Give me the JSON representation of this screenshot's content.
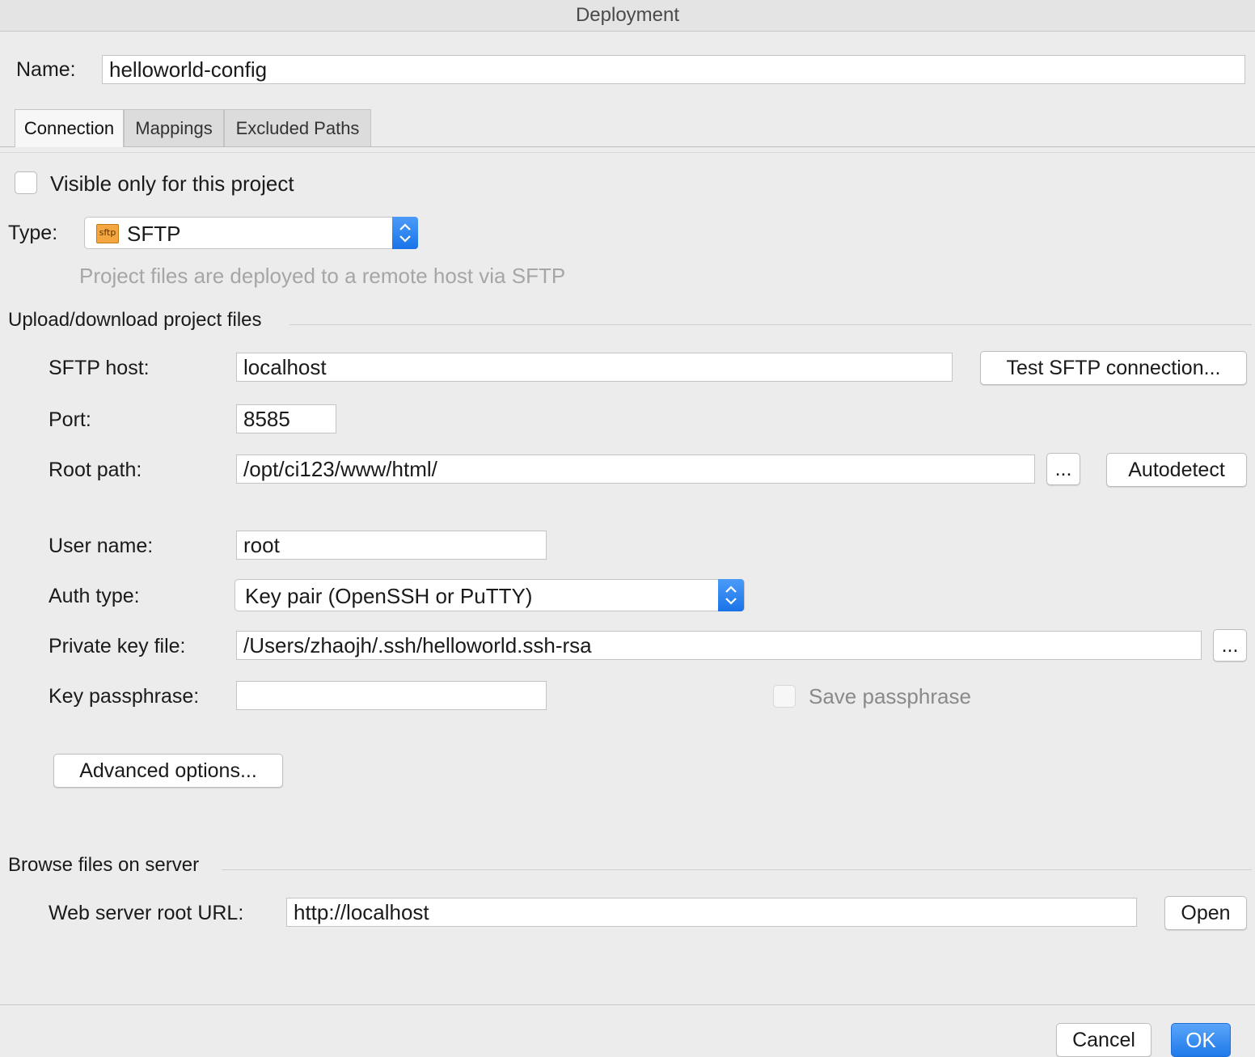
{
  "window": {
    "title": "Deployment"
  },
  "name_field": {
    "label": "Name:",
    "value": "helloworld-config"
  },
  "tabs": [
    {
      "label": "Connection",
      "active": true
    },
    {
      "label": "Mappings",
      "active": false
    },
    {
      "label": "Excluded Paths",
      "active": false
    }
  ],
  "visible_only": {
    "label": "Visible only for this project",
    "checked": false
  },
  "type": {
    "label": "Type:",
    "value": "SFTP",
    "icon": "sftp-icon",
    "icon_text": "sftp",
    "hint": "Project files are deployed to a remote host via SFTP"
  },
  "upload_section": {
    "title": "Upload/download project files"
  },
  "sftp_host": {
    "label": "SFTP host:",
    "value": "localhost",
    "test_button": "Test SFTP connection..."
  },
  "port": {
    "label": "Port:",
    "value": "8585"
  },
  "root_path": {
    "label": "Root path:",
    "value": "/opt/ci123/www/html/",
    "browse_button": "...",
    "autodetect_button": "Autodetect"
  },
  "user_name": {
    "label": "User name:",
    "value": "root"
  },
  "auth_type": {
    "label": "Auth type:",
    "value": "Key pair (OpenSSH or PuTTY)"
  },
  "private_key": {
    "label": "Private key file:",
    "value": "/Users/zhaojh/.ssh/helloworld.ssh-rsa",
    "browse_button": "..."
  },
  "key_passphrase": {
    "label": "Key passphrase:",
    "value": "",
    "save_label": "Save passphrase"
  },
  "advanced_button": "Advanced options...",
  "browse_section": {
    "title": "Browse files on server"
  },
  "web_root": {
    "label": "Web server root URL:",
    "value": "http://localhost",
    "open_button": "Open"
  },
  "footer": {
    "cancel": "Cancel",
    "ok": "OK"
  },
  "colors": {
    "accent": "#1f7ae8",
    "background": "#ececec"
  }
}
